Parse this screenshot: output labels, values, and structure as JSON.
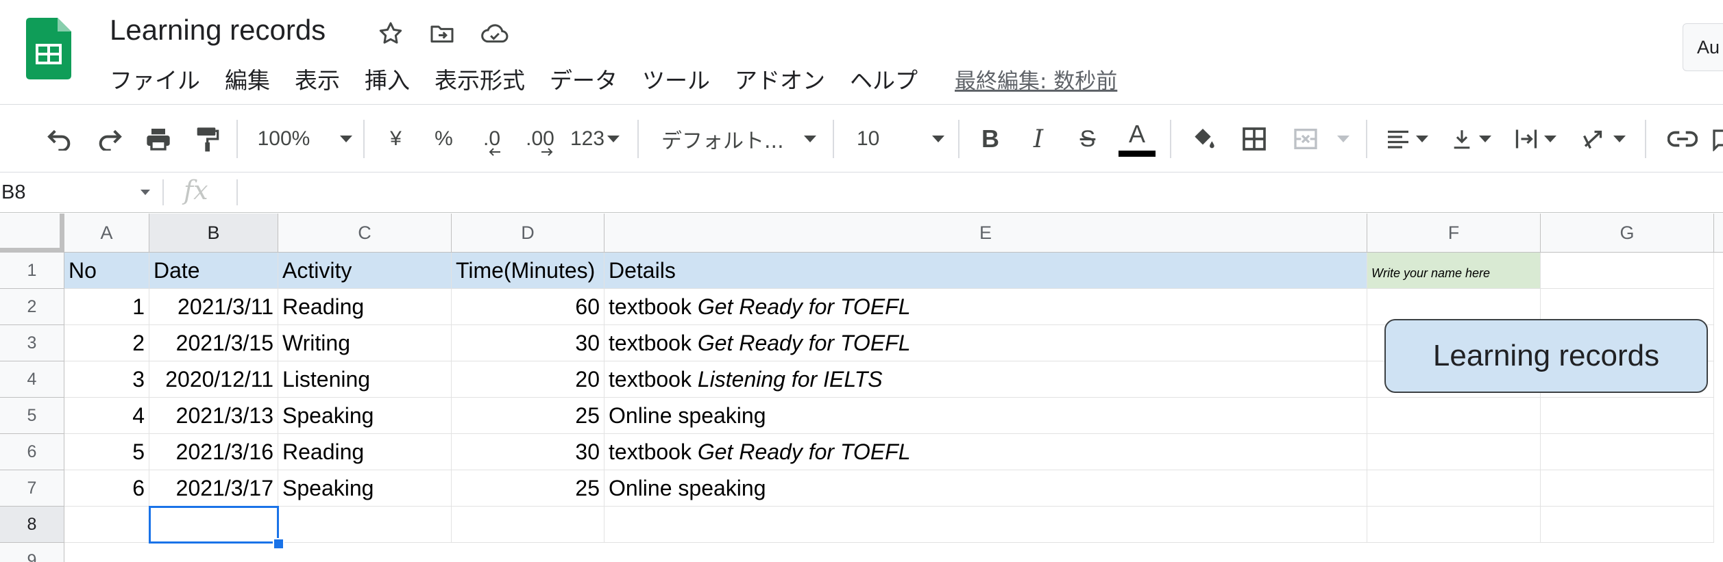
{
  "app": {
    "title": "Learning records",
    "last_edit": "最終編集: 数秒前",
    "share_label": "Au"
  },
  "menu": [
    "ファイル",
    "編集",
    "表示",
    "挿入",
    "表示形式",
    "データ",
    "ツール",
    "アドオン",
    "ヘルプ"
  ],
  "toolbar": {
    "zoom": "100%",
    "currency": "¥",
    "percent": "%",
    "decimal_decrease": ".0",
    "decimal_increase": ".00",
    "more_formats": "123",
    "font": "デフォルト...",
    "font_size": "10",
    "text_color": "#000000"
  },
  "formula_bar": {
    "cell_ref": "B8",
    "fx": "fx",
    "value": ""
  },
  "columns": [
    "A",
    "B",
    "C",
    "D",
    "E",
    "F",
    "G"
  ],
  "rows": [
    "1",
    "2",
    "3",
    "4",
    "5",
    "6",
    "7",
    "8",
    "9"
  ],
  "sheet": {
    "header": {
      "no": "No",
      "date": "Date",
      "activity": "Activity",
      "time": "Time(Minutes)",
      "details": "Details",
      "name_prompt": "Write your name here"
    },
    "rows": [
      {
        "no": "1",
        "date": "2021/3/11",
        "activity": "Reading",
        "time": "60",
        "details_prefix": "textbook ",
        "details_italic": "Get Ready for TOEFL"
      },
      {
        "no": "2",
        "date": "2021/3/15",
        "activity": "Writing",
        "time": "30",
        "details_prefix": "textbook ",
        "details_italic": "Get Ready for TOEFL"
      },
      {
        "no": "3",
        "date": "2020/12/11",
        "activity": "Listening",
        "time": "20",
        "details_prefix": "textbook ",
        "details_italic": "Listening for IELTS"
      },
      {
        "no": "4",
        "date": "2021/3/13",
        "activity": "Speaking",
        "time": "25",
        "details_prefix": "Online speaking",
        "details_italic": ""
      },
      {
        "no": "5",
        "date": "2021/3/16",
        "activity": "Reading",
        "time": "30",
        "details_prefix": "textbook ",
        "details_italic": "Get Ready for TOEFL"
      },
      {
        "no": "6",
        "date": "2021/3/17",
        "activity": "Speaking",
        "time": "25",
        "details_prefix": "Online speaking",
        "details_italic": ""
      }
    ],
    "drawing_label": "Learning records",
    "selected_cell": "B8"
  },
  "colors": {
    "header_fill": "#cfe2f3",
    "name_cell_fill": "#d9ead3",
    "selection": "#1a73e8",
    "logo": "#0f9d58"
  }
}
